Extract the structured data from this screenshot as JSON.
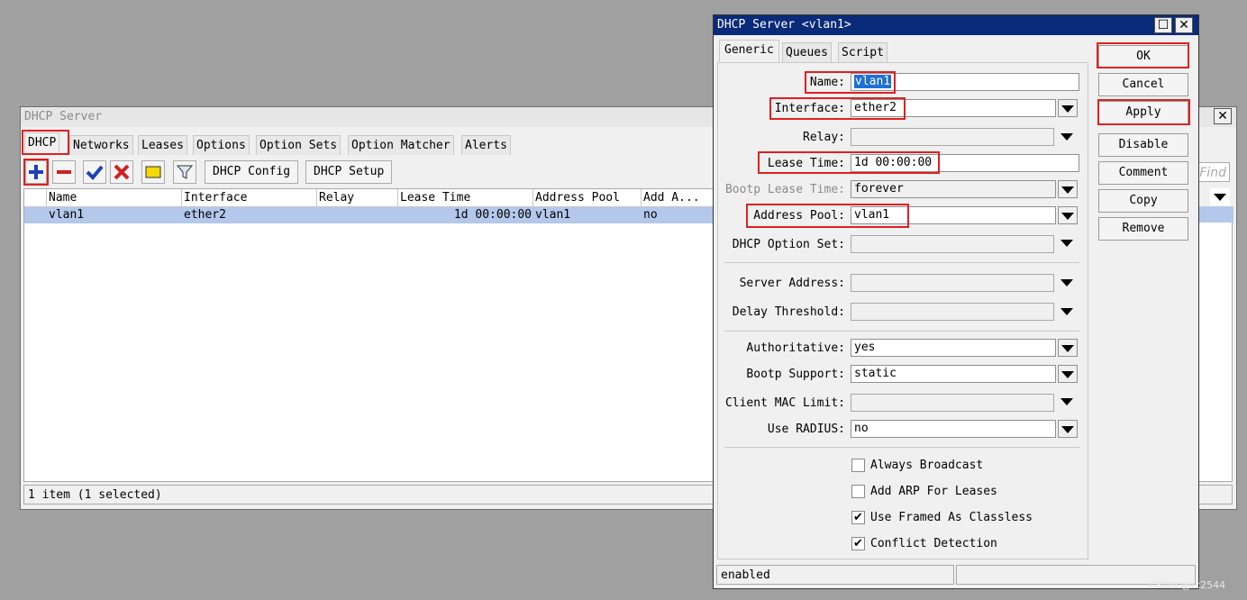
{
  "bg_window": {
    "title": "DHCP Server",
    "tabs": [
      "DHCP",
      "Networks",
      "Leases",
      "Options",
      "Option Sets",
      "Option Matcher",
      "Alerts"
    ],
    "toolbar": {
      "config_label": "DHCP Config",
      "setup_label": "DHCP Setup"
    },
    "columns": [
      "Name",
      "Interface",
      "Relay",
      "Lease Time",
      "Address Pool",
      "Add A..."
    ],
    "rows": [
      {
        "name": "vlan1",
        "interface": "ether2",
        "relay": "",
        "lease_time": "1d 00:00:00",
        "address_pool": "vlan1",
        "add_arp": "no"
      }
    ],
    "status": "1 item (1 selected)"
  },
  "right_window": {
    "find_placeholder": "Find",
    "close_glyph": "✕"
  },
  "dialog": {
    "title": "DHCP Server <vlan1>",
    "tabs": [
      "Generic",
      "Queues",
      "Script"
    ],
    "fields": {
      "name": {
        "label": "Name:",
        "value": "vlan1"
      },
      "interface": {
        "label": "Interface:",
        "value": "ether2"
      },
      "relay": {
        "label": "Relay:",
        "value": ""
      },
      "lease_time": {
        "label": "Lease Time:",
        "value": "1d 00:00:00"
      },
      "bootp_lease_time": {
        "label": "Bootp Lease Time:",
        "value": "forever"
      },
      "address_pool": {
        "label": "Address Pool:",
        "value": "vlan1"
      },
      "dhcp_option_set": {
        "label": "DHCP Option Set:",
        "value": ""
      },
      "server_address": {
        "label": "Server Address:",
        "value": ""
      },
      "delay_threshold": {
        "label": "Delay Threshold:",
        "value": ""
      },
      "authoritative": {
        "label": "Authoritative:",
        "value": "yes"
      },
      "bootp_support": {
        "label": "Bootp Support:",
        "value": "static"
      },
      "client_mac_limit": {
        "label": "Client MAC Limit:",
        "value": ""
      },
      "use_radius": {
        "label": "Use RADIUS:",
        "value": "no"
      }
    },
    "checkboxes": {
      "always_broadcast": {
        "label": "Always Broadcast",
        "checked": false
      },
      "add_arp": {
        "label": "Add ARP For Leases",
        "checked": false
      },
      "use_framed": {
        "label": "Use Framed As Classless",
        "checked": true
      },
      "conflict_detection": {
        "label": "Conflict Detection",
        "checked": true
      }
    },
    "buttons": {
      "ok": "OK",
      "cancel": "Cancel",
      "apply": "Apply",
      "disable": "Disable",
      "comment": "Comment",
      "copy": "Copy",
      "remove": "Remove"
    },
    "status": "enabled",
    "check_glyph": "✔",
    "maximize_glyph": "☐",
    "close_glyph": "✕"
  },
  "colors": {
    "highlight": "#e02020",
    "title_active": "#0a2a7a",
    "selection": "#1e6fd6",
    "row_selected": "#b4c8ec"
  },
  "watermark": "CSDN @rc2544"
}
